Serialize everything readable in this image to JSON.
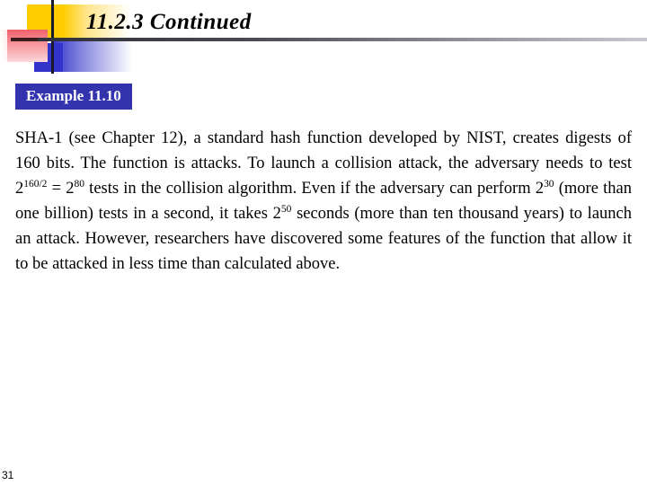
{
  "slide": {
    "title": "11.2.3  Continued",
    "page_number": "31",
    "example_label": "Example 11.10",
    "accent_colors": {
      "yellow": "#FFCC00",
      "red": "#F0616B",
      "blue": "#3333CC",
      "label_blue": "#3333AD",
      "rule_dark": "#30303a",
      "text": "#000000"
    },
    "body": {
      "part1": "SHA-1 (see Chapter 12), a standard hash function developed by NIST, creates digests of 160 bits. The function is attacks. To launch a collision attack, the adversary needs to test ",
      "eq1_base": "2",
      "eq1_exp": "160/2",
      "eq1_equals": " = ",
      "eq2_base": "2",
      "eq2_exp": "80",
      "part2": " tests in the collision algorithm. Even if the adversary can perform ",
      "eq3_base": "2",
      "eq3_exp": "30",
      "part3": " (more than one billion) tests in a second, it takes ",
      "eq4_base": "2",
      "eq4_exp": "50",
      "part4": " seconds (more than ten thousand years) to launch an attack. However, researchers have discovered some features of the function that allow it to be attacked in less time than calculated above."
    }
  }
}
